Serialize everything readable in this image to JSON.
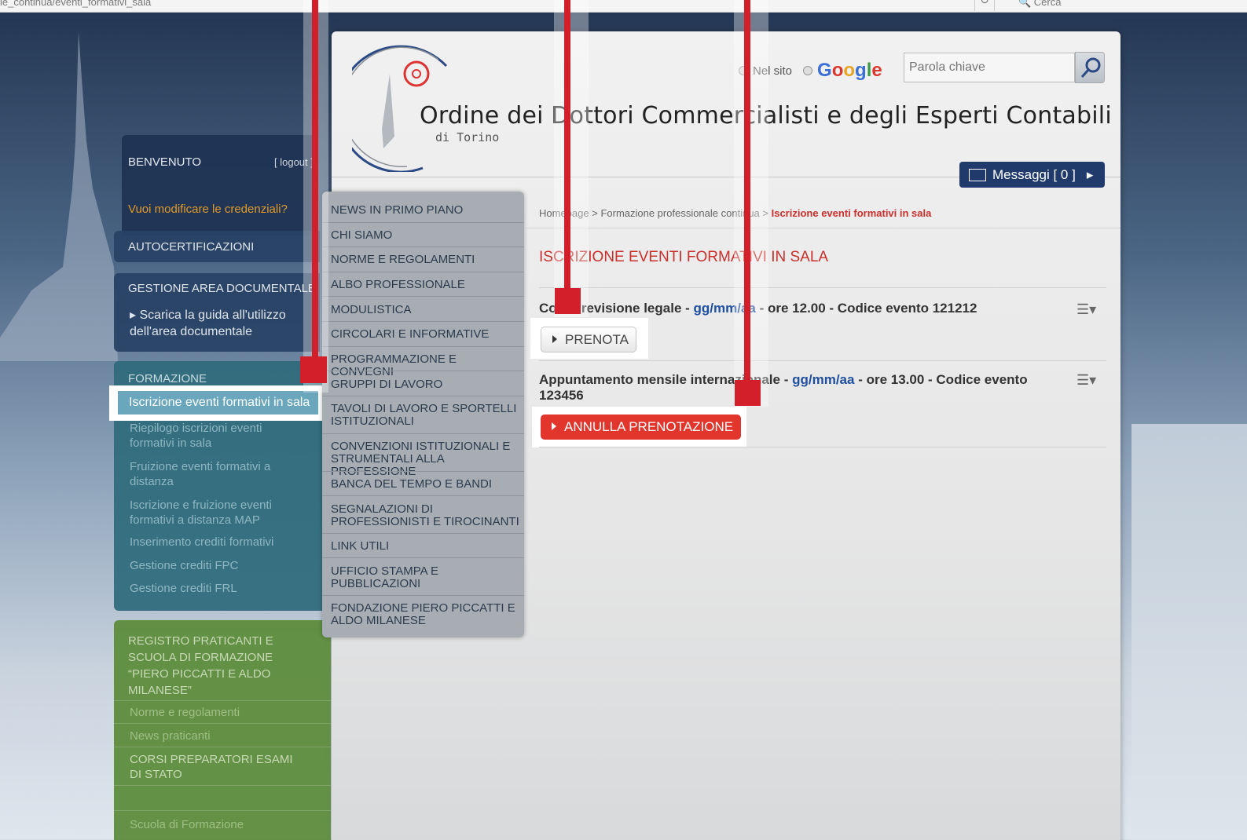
{
  "browser": {
    "url_fragment": "ie_continua/eventi_formativi_sala",
    "refresh_glyph": "↻",
    "search_fragment": "🔍 Cerca"
  },
  "header": {
    "title": "Ordine dei Dottori Commercialisti e degli Esperti Contabili",
    "subtitle": "di Torino",
    "search_scope_site": "Nel sito",
    "search_scope_google": "Google",
    "search_placeholder": "Parola chiave",
    "messages_label": "Messaggi [ 0 ]"
  },
  "sidebar": {
    "welcome": "BENVENUTO",
    "logout": "[ logout ]",
    "change_credentials": "Vuoi modificare le credenziali?",
    "autocert": "AUTOCERTIFICAZIONI",
    "doc_area": "GESTIONE AREA DOCUMENTALE",
    "doc_guide": "Scarica la guida all'utilizzo dell'area documentale",
    "formazione": "FORMAZIONE",
    "formazione_items": [
      "Iscrizione eventi formativi in sala",
      "Riepilogo iscrizioni eventi formativi in sala",
      "Fruizione eventi formativi a distanza",
      "Iscrizione e fruizione eventi formativi a distanza MAP",
      "Inserimento crediti formativi",
      "Gestione crediti FPC",
      "Gestione crediti FRL"
    ],
    "registro": "REGISTRO PRATICANTI E SCUOLA DI FORMAZIONE “PIERO PICCATTI E ALDO MILANESE”",
    "registro_items": [
      "Norme e regolamenti",
      "News praticanti",
      "CORSI PREPARATORI ESAMI DI STATO",
      "Scuola di Formazione"
    ]
  },
  "nav": {
    "items": [
      "NEWS IN PRIMO PIANO",
      "CHI SIAMO",
      "NORME E REGOLAMENTI",
      "ALBO PROFESSIONALE",
      "MODULISTICA",
      "CIRCOLARI E INFORMATIVE",
      "PROGRAMMAZIONE E CONVEGNI",
      "GRUPPI DI LAVORO",
      "TAVOLI DI LAVORO E SPORTELLI ISTITUZIONALI",
      "CONVENZIONI ISTITUZIONALI E STRUMENTALI ALLA PROFESSIONE",
      "BANCA DEL TEMPO E BANDI",
      "SEGNALAZIONI DI PROFESSIONISTI E TIROCINANTI",
      "LINK UTILI",
      "UFFICIO STAMPA E PUBBLICAZIONI",
      "FONDAZIONE PIERO PICCATTI E ALDO MILANESE"
    ]
  },
  "content": {
    "breadcrumb": {
      "home": "Homepage",
      "sep": " > ",
      "section": "Formazione professionale continua",
      "current": "Iscrizione eventi formativi in sala"
    },
    "heading": "ISCRIZIONE EVENTI FORMATIVI IN SALA",
    "events": [
      {
        "title": "Corso revisione legale",
        "date": "gg/mm/aa",
        "rest": " - ore 12.00 - Codice evento 121212",
        "action": "PRENOTA"
      },
      {
        "title": "Appuntamento mensile internazionale",
        "date": "gg/mm/aa",
        "rest": " - ore 13.00 - Codice evento 123456",
        "action": "ANNULLA PRENOTAZIONE"
      }
    ],
    "list_icon_glyph": "☰▾"
  },
  "colors": {
    "accent_red": "#c9302c",
    "annotation_red": "#d21f2a",
    "button_red": "#e2362c",
    "date_blue": "#1e4fa0",
    "nav_blue": "#1f3a6b"
  }
}
